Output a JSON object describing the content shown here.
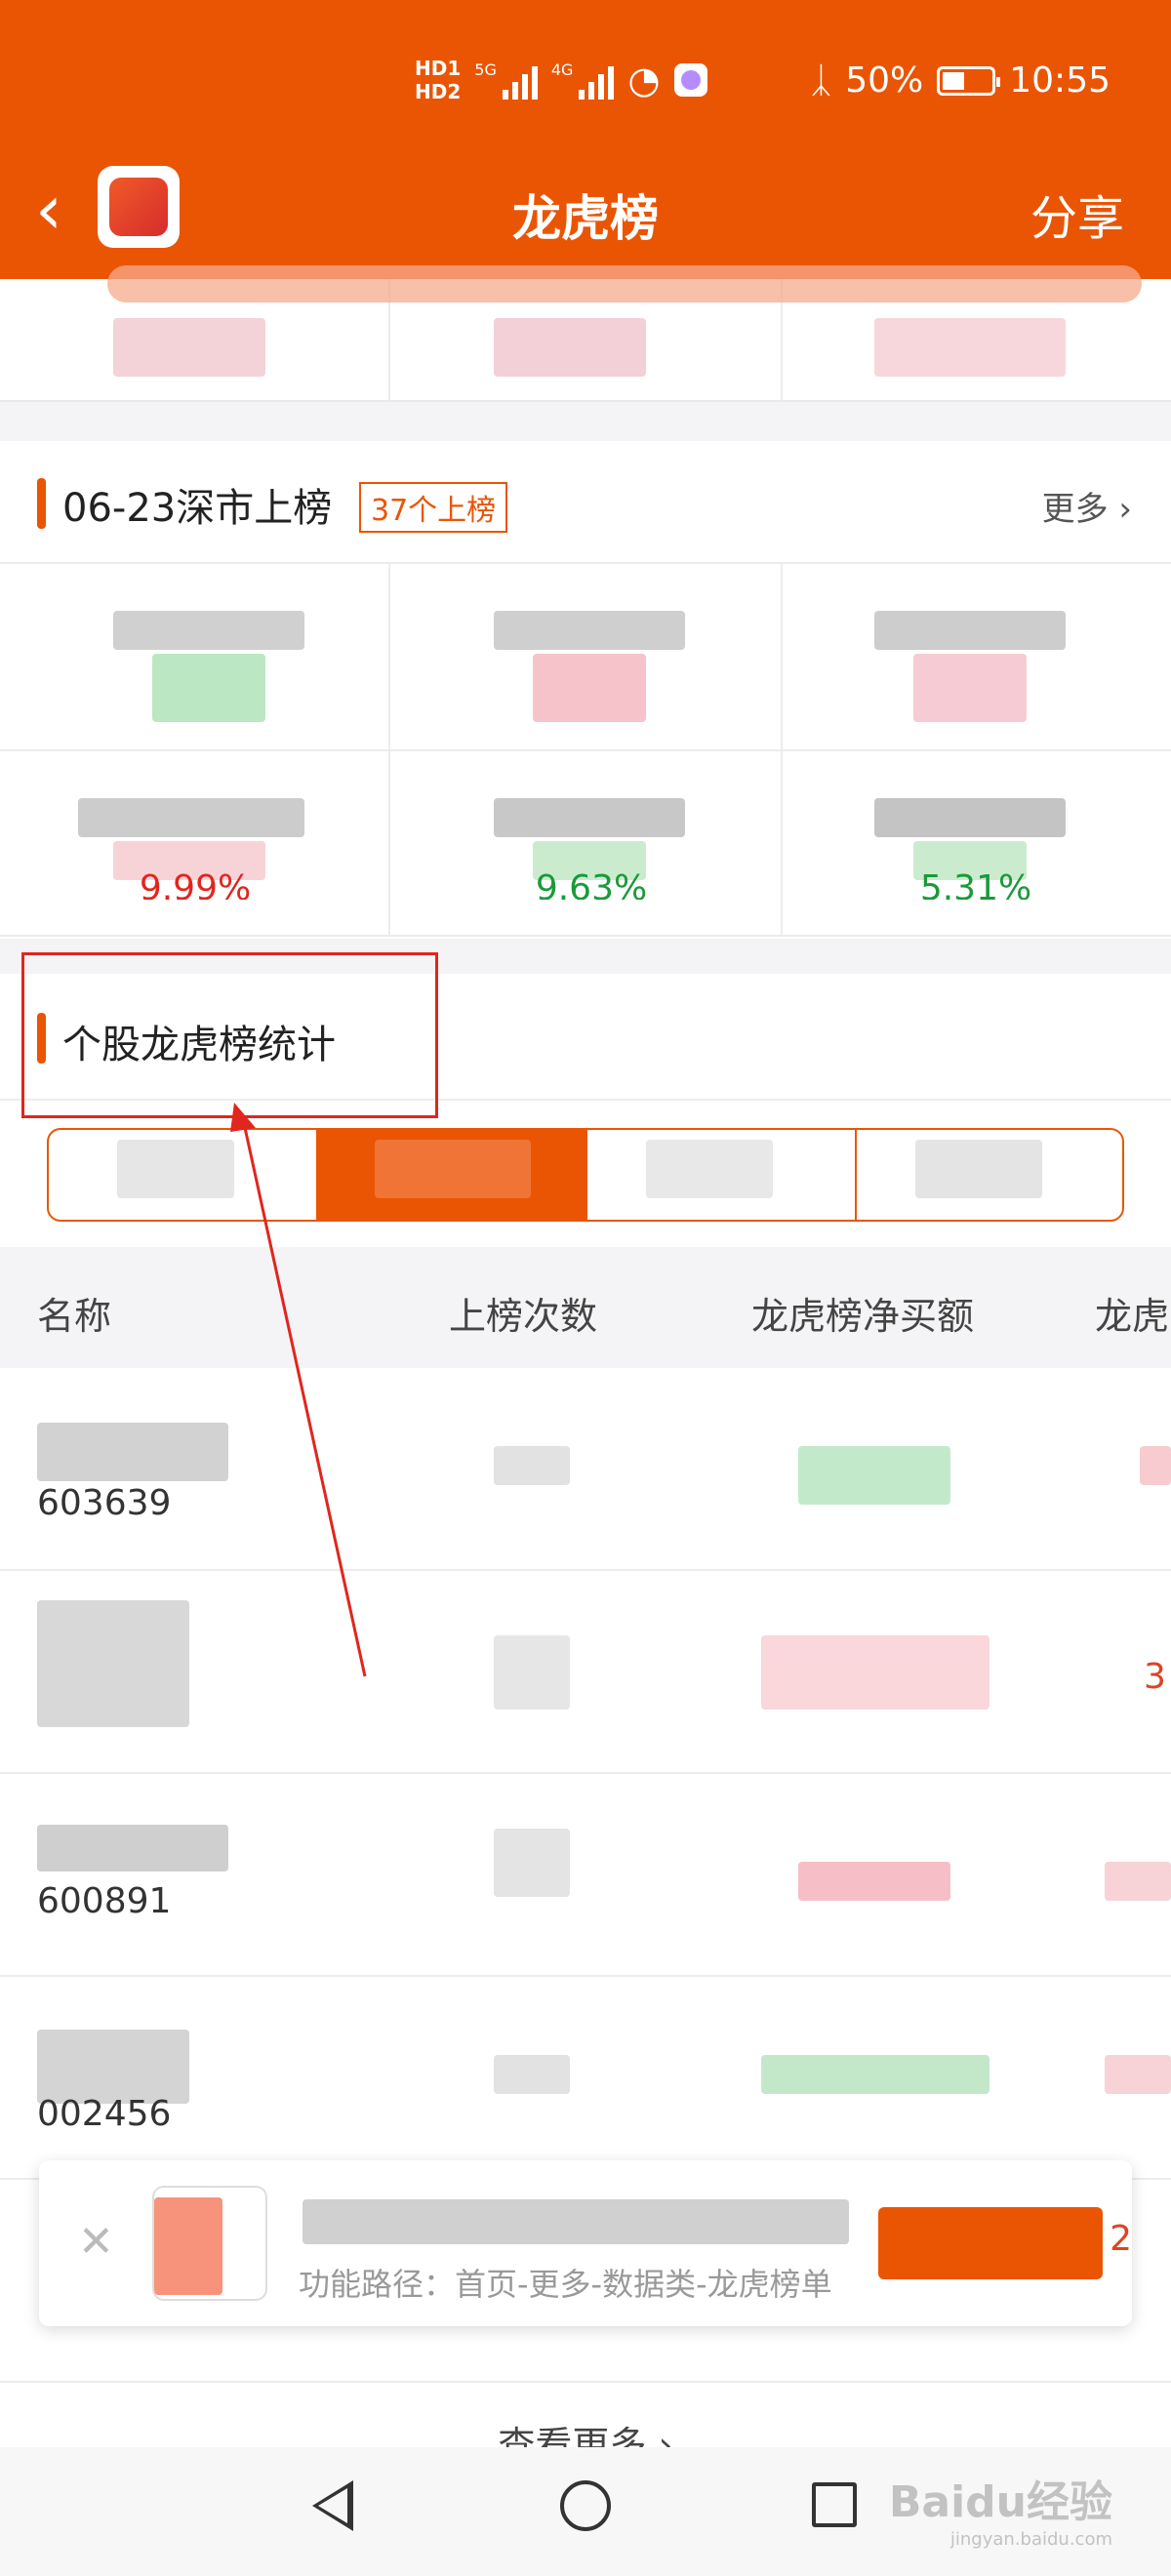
{
  "status_bar": {
    "hd1": "HD1",
    "hd2": "HD2",
    "net5g": "5G",
    "net4g": "4G",
    "battery": "50%",
    "time": "10:55"
  },
  "nav": {
    "title": "龙虎榜",
    "share": "分享"
  },
  "shenshi": {
    "title": "06-23深市上榜",
    "badge": "37个上榜",
    "more": "更多"
  },
  "grid": {
    "row2_values": [
      "9.99%",
      "9.63%",
      "5.31%"
    ]
  },
  "stats": {
    "title": "个股龙虎榜统计"
  },
  "table": {
    "headers": [
      "名称",
      "上榜次数",
      "龙虎榜净买额",
      "龙虎"
    ],
    "codes": [
      "603639",
      "",
      "600891",
      "002456"
    ],
    "right_values": [
      "",
      "3",
      "",
      ""
    ]
  },
  "card": {
    "path": "功能路径：首页-更多-数据类-龙虎榜单",
    "right": "2"
  },
  "footer": {
    "view_more": "查看更多"
  },
  "watermark": {
    "brand": "Baidu经验",
    "url": "jingyan.baidu.com"
  },
  "colors": {
    "brand": "#ea5504",
    "rise": "#e0261e",
    "fall": "#1a9a3a"
  }
}
